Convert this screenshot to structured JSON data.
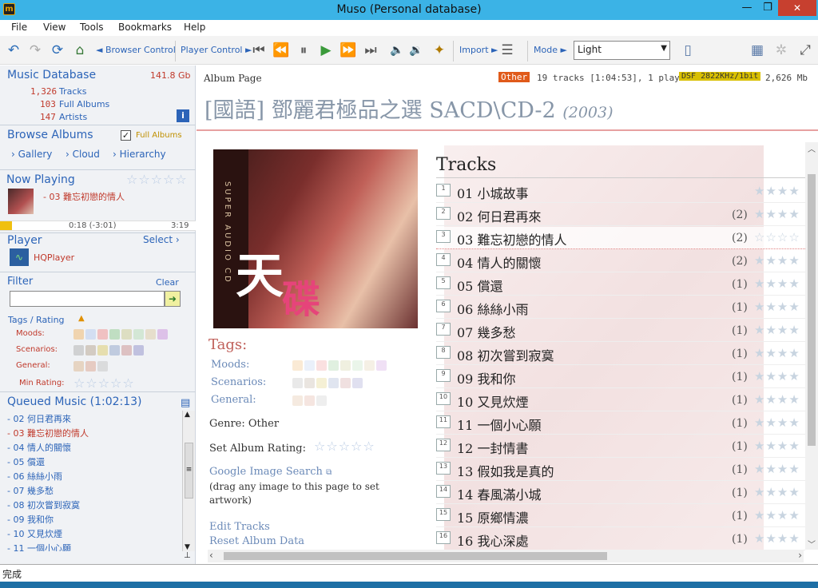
{
  "window": {
    "title": "Muso (Personal database)",
    "min": "—",
    "max": "❐",
    "close": "✕"
  },
  "menu": [
    "File",
    "View",
    "Tools",
    "Bookmarks",
    "Help"
  ],
  "toolbar": {
    "browser_control": "◄ Browser Control",
    "player_control": "Player Control ►",
    "import": "Import ►",
    "mode": "Mode ►",
    "mode_value": "Light"
  },
  "sidebar": {
    "db_title": "Music Database",
    "db_size": "141.8 Gb",
    "tracks_count": "1,326",
    "tracks_label": "Tracks",
    "albums_count": "103",
    "albums_label": "Full Albums",
    "artists_count": "147",
    "artists_label": "Artists",
    "browse_title": "Browse Albums",
    "full_albums_label": "Full Albums",
    "browse_links": [
      "Gallery",
      "Cloud",
      "Hierarchy"
    ],
    "now_playing_title": "Now Playing",
    "now_playing_track": "- 03 難忘初戀的情人",
    "progress_fraction": 0.06,
    "time_current": "0:18  (-3:01)",
    "time_total": "3:19",
    "player_title": "Player",
    "player_select": "Select",
    "player_name": "HQPlayer",
    "filter_title": "Filter",
    "filter_clear": "Clear",
    "filter_value": "",
    "tags_rating": "Tags / Rating",
    "moods_label": "Moods:",
    "scenarios_label": "Scenarios:",
    "general_label": "General:",
    "min_rating_label": "Min Rating:",
    "queue_title": "Queued Music (1:02:13)",
    "queue": [
      "- 02 何日君再來",
      "- 03 難忘初戀的情人",
      "- 04 情人的關懷",
      "- 05 償還",
      "- 06 絲絲小雨",
      "- 07 幾多愁",
      "- 08 初次嘗到寂寞",
      "- 09 我和你",
      "- 10 又見炊煙",
      "- 11 一個小心願"
    ],
    "queue_current_index": 1
  },
  "album": {
    "page_label": "Album Page",
    "badge_other": "Other",
    "summary": "19 tracks [1:04:53], 1 play",
    "badge_format": "DSF 2822KHz/1bit",
    "size": "2,626 Mb",
    "title": "[國語] 鄧麗君極品之選 SACD\\CD-2",
    "year": "(2003)",
    "art_big_char_1": "天",
    "art_big_char_2": "碟",
    "art_spine_text": "SUPER AUDIO CD",
    "tags_title": "Tags:",
    "moods_label": "Moods:",
    "scenarios_label": "Scenarios:",
    "general_label": "General:",
    "genre": "Genre: Other",
    "set_rating": "Set Album Rating:",
    "google_search": "Google Image Search",
    "drag_hint": "(drag any image to this page to set artwork)",
    "edit_tracks": "Edit Tracks",
    "reset_album": "Reset Album Data",
    "tracks_title": "Tracks"
  },
  "tracks": [
    {
      "n": "1",
      "title": "01  小城故事",
      "count": ""
    },
    {
      "n": "2",
      "title": "02  何日君再來",
      "count": "(2)"
    },
    {
      "n": "3",
      "title": "03  難忘初戀的情人",
      "count": "(2)"
    },
    {
      "n": "4",
      "title": "04  情人的關懷",
      "count": "(2)"
    },
    {
      "n": "5",
      "title": "05  償還",
      "count": "(1)"
    },
    {
      "n": "6",
      "title": "06  絲絲小雨",
      "count": "(1)"
    },
    {
      "n": "7",
      "title": "07  幾多愁",
      "count": "(1)"
    },
    {
      "n": "8",
      "title": "08  初次嘗到寂寞",
      "count": "(1)"
    },
    {
      "n": "9",
      "title": "09  我和你",
      "count": "(1)"
    },
    {
      "n": "10",
      "title": "10  又見炊煙",
      "count": "(1)"
    },
    {
      "n": "11",
      "title": "11  一個小心願",
      "count": "(1)"
    },
    {
      "n": "12",
      "title": "12  一封情書",
      "count": "(1)"
    },
    {
      "n": "13",
      "title": "13  假如我是真的",
      "count": "(1)"
    },
    {
      "n": "14",
      "title": "14  春風滿小城",
      "count": "(1)"
    },
    {
      "n": "15",
      "title": "15  原鄉情濃",
      "count": "(1)"
    },
    {
      "n": "16",
      "title": "16  我心深處",
      "count": "(1)"
    }
  ],
  "status": "完成",
  "colors": {
    "accent": "#2c64b8",
    "title_bar": "#3bb3e6",
    "red": "#c0392b",
    "badge_yellow": "#d9c000"
  },
  "icons": [
    "app-icon",
    "back-icon",
    "forward-icon",
    "refresh-icon",
    "home-icon",
    "prev-track-icon",
    "rewind-icon",
    "pause-icon",
    "play-icon",
    "fast-forward-icon",
    "next-track-icon",
    "volume-down-icon",
    "volume-up-icon",
    "magic-wand-icon",
    "list-icon",
    "device-icon",
    "grid-icon",
    "bug-icon",
    "fullscreen-icon",
    "info-icon",
    "search-go-icon",
    "external-link-icon"
  ]
}
